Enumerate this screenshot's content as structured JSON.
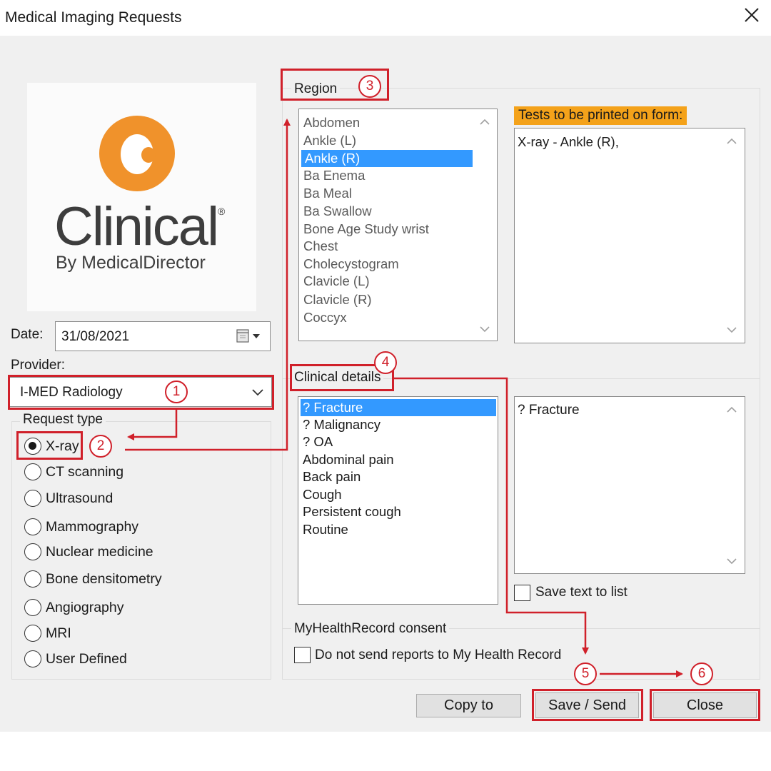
{
  "window": {
    "title": "Medical Imaging Requests"
  },
  "logo": {
    "brand": "Clinical",
    "trademark": "®",
    "tagline": "By MedicalDirector",
    "accent_color": "#f0922b"
  },
  "date": {
    "label": "Date:",
    "value": "31/08/2021"
  },
  "provider": {
    "label": "Provider:",
    "value": "I-MED Radiology"
  },
  "request_type": {
    "legend": "Request type",
    "options": [
      {
        "label": "X-ray",
        "selected": true
      },
      {
        "label": "CT scanning",
        "selected": false
      },
      {
        "label": "Ultrasound",
        "selected": false
      },
      {
        "label": "Mammography",
        "selected": false
      },
      {
        "label": "Nuclear medicine",
        "selected": false
      },
      {
        "label": "Bone densitometry",
        "selected": false
      },
      {
        "label": "Angiography",
        "selected": false
      },
      {
        "label": "MRI",
        "selected": false
      },
      {
        "label": "User Defined",
        "selected": false
      }
    ]
  },
  "region": {
    "legend": "Region",
    "items": [
      "Abdomen",
      "Ankle (L)",
      "Ankle (R)",
      "Ba Enema",
      "Ba Meal",
      "Ba Swallow",
      "Bone Age Study wrist",
      "Chest",
      "Cholecystogram",
      "Clavicle (L)",
      "Clavicle (R)",
      "Coccyx"
    ],
    "selected_index": 2
  },
  "tests": {
    "header": "Tests to be printed on form:",
    "text": "X-ray - Ankle (R),"
  },
  "clinical": {
    "legend": "Clinical details",
    "items": [
      "? Fracture",
      "? Malignancy",
      "? OA",
      "Abdominal pain",
      "Back pain",
      "Cough",
      "Persistent cough",
      "Routine"
    ],
    "selected_index": 0,
    "text": "? Fracture",
    "save_text_label": "Save text to list"
  },
  "mhr": {
    "legend": "MyHealthRecord consent",
    "checkbox_label": "Do not send reports to My Health Record"
  },
  "buttons": {
    "copy_to": "Copy to",
    "save_send": "Save / Send",
    "close": "Close"
  },
  "steps": [
    "1",
    "2",
    "3",
    "4",
    "5",
    "6"
  ],
  "colors": {
    "annotation_red": "#d0202a",
    "selection_blue": "#3399ff",
    "tests_header_orange": "#f4a21a"
  }
}
